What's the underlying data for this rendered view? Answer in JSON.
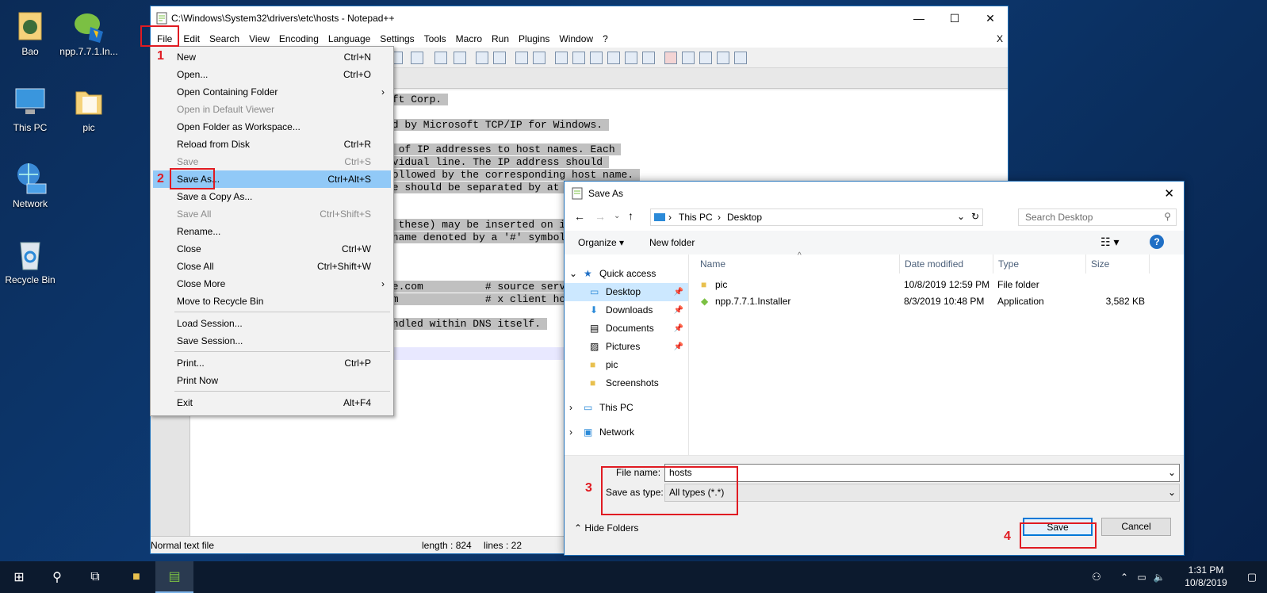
{
  "desktop": {
    "icons": [
      {
        "label": "Bao"
      },
      {
        "label": "npp.7.7.1.In..."
      },
      {
        "label": "This PC"
      },
      {
        "label": "pic"
      },
      {
        "label": "Network"
      },
      {
        "label": "Recycle Bin"
      }
    ]
  },
  "notepad": {
    "title": "C:\\Windows\\System32\\drivers\\etc\\hosts - Notepad++",
    "menu": [
      "File",
      "Edit",
      "Search",
      "View",
      "Encoding",
      "Language",
      "Settings",
      "Tools",
      "Macro",
      "Run",
      "Plugins",
      "Window",
      "?"
    ],
    "menu_close": "X",
    "code_lines": [
      {
        "text": "oft Corp. "
      },
      {
        "text": "ed by Microsoft TCP/IP for Windows. "
      },
      {
        "text": "s of IP addresses to host names. Each "
      },
      {
        "text": "ividual line. The IP address should "
      },
      {
        "text": "followed by the corresponding host name. "
      },
      {
        "text": "me should be separated by at least one "
      },
      {
        "text": "s these) may be inserted on individual "
      },
      {
        "text": " name denoted by a '#' symbol."
      },
      {
        "text": "me.com          # source server"
      },
      {
        "text": "om              # x client host"
      },
      {
        "text": "andled within DNS itself. "
      }
    ],
    "status": {
      "type": "Normal text file",
      "length": "length : 824",
      "lines": "lines : 22"
    }
  },
  "file_menu": {
    "items": [
      {
        "label": "New",
        "shortcut": "Ctrl+N"
      },
      {
        "label": "Open...",
        "shortcut": "Ctrl+O"
      },
      {
        "label": "Open Containing Folder",
        "shortcut": "",
        "submenu": "›"
      },
      {
        "label": "Open in Default Viewer",
        "shortcut": ""
      },
      {
        "label": "Open Folder as Workspace...",
        "shortcut": ""
      },
      {
        "label": "Reload from Disk",
        "shortcut": "Ctrl+R"
      },
      {
        "label": "Save",
        "shortcut": "Ctrl+S"
      },
      {
        "label": "Save As...",
        "shortcut": "Ctrl+Alt+S"
      },
      {
        "label": "Save a Copy As...",
        "shortcut": ""
      },
      {
        "label": "Save All",
        "shortcut": "Ctrl+Shift+S"
      },
      {
        "label": "Rename...",
        "shortcut": ""
      },
      {
        "label": "Close",
        "shortcut": "Ctrl+W"
      },
      {
        "label": "Close All",
        "shortcut": "Ctrl+Shift+W"
      },
      {
        "label": "Close More",
        "shortcut": "",
        "submenu": "›"
      },
      {
        "label": "Move to Recycle Bin",
        "shortcut": ""
      },
      {
        "label": "Load Session...",
        "shortcut": ""
      },
      {
        "label": "Save Session...",
        "shortcut": ""
      },
      {
        "label": "Print...",
        "shortcut": "Ctrl+P"
      },
      {
        "label": "Print Now",
        "shortcut": ""
      },
      {
        "label": "Exit",
        "shortcut": "Alt+F4"
      }
    ]
  },
  "annotations": {
    "n1": "1",
    "n2": "2",
    "n3": "3",
    "n4": "4"
  },
  "save_dialog": {
    "title": "Save As",
    "breadcrumb": [
      "This PC",
      "Desktop"
    ],
    "search_placeholder": "Search Desktop",
    "organize": "Organize ▾",
    "new_folder": "New folder",
    "help": "?",
    "nav": {
      "quick_access": "Quick access",
      "items": [
        "Desktop",
        "Downloads",
        "Documents",
        "Pictures",
        "pic",
        "Screenshots"
      ],
      "this_pc": "This PC",
      "network": "Network"
    },
    "columns": {
      "name": "Name",
      "date": "Date modified",
      "type": "Type",
      "size": "Size"
    },
    "files": [
      {
        "name": "pic",
        "date": "10/8/2019 12:59 PM",
        "type": "File folder",
        "size": ""
      },
      {
        "name": "npp.7.7.1.Installer",
        "date": "8/3/2019 10:48 PM",
        "type": "Application",
        "size": "3,582 KB"
      }
    ],
    "file_name_label": "File name:",
    "file_name_value": "hosts",
    "save_type_label": "Save as type:",
    "save_type_value": "All types (*.*)",
    "hide_folders": "Hide Folders",
    "save": "Save",
    "cancel": "Cancel"
  },
  "taskbar": {
    "time": "1:31 PM",
    "date": "10/8/2019"
  }
}
